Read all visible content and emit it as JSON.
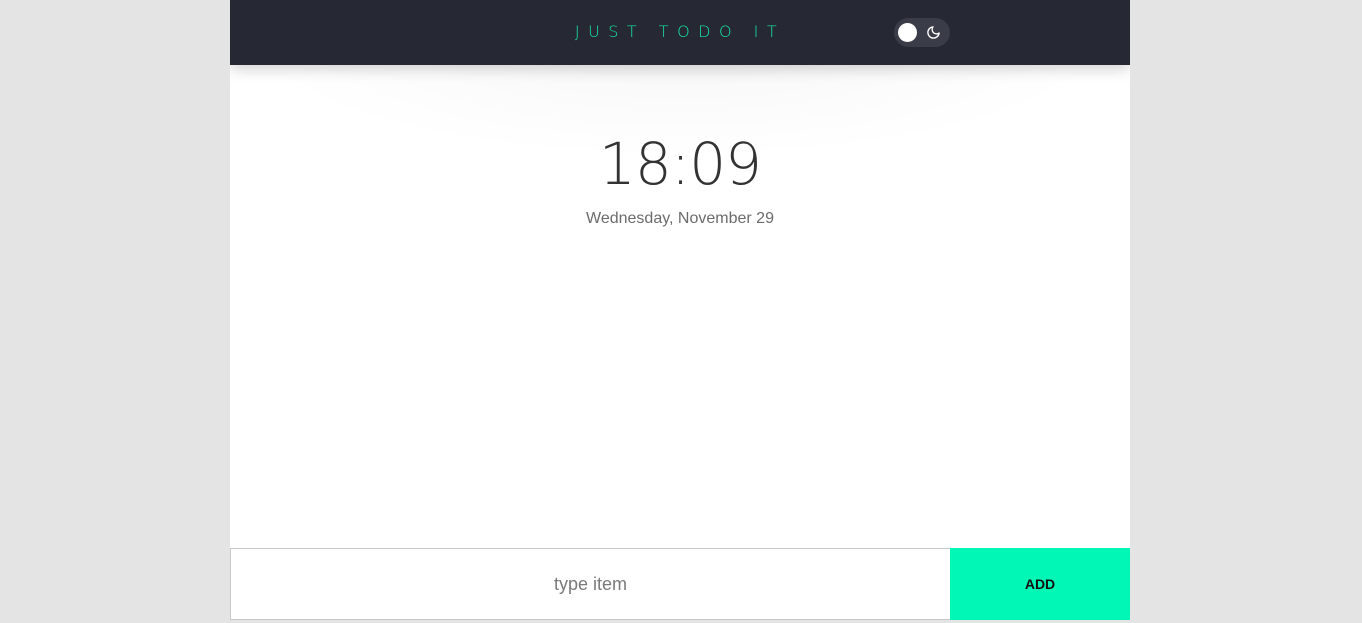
{
  "header": {
    "brand": "JUST TODO IT",
    "theme_toggle_icon": "moon-icon"
  },
  "main": {
    "time": "18:09",
    "date": "Wednesday, November 29"
  },
  "form": {
    "placeholder": "type item",
    "add_label": "ADD"
  },
  "colors": {
    "background": "#e4e4e4",
    "header": "#262833",
    "accent": "#00f7b6",
    "brand_text": "#18e6a6"
  }
}
